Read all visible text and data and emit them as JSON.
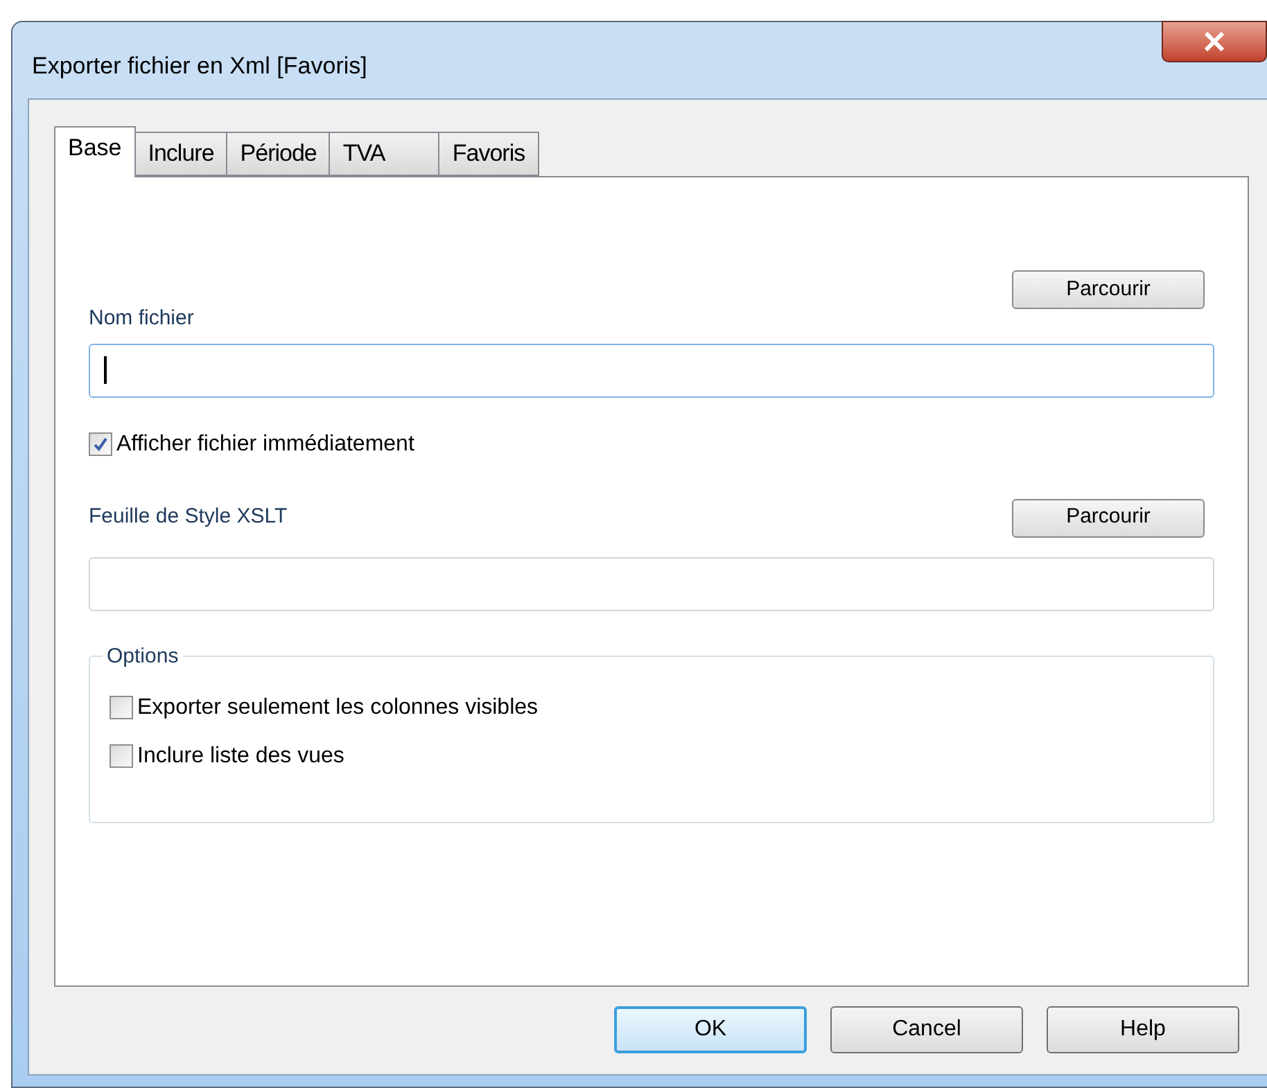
{
  "window": {
    "title": "Exporter fichier en Xml [Favoris]"
  },
  "tabs": [
    {
      "label": "Base",
      "selected": true
    },
    {
      "label": "Inclure",
      "selected": false
    },
    {
      "label": "Période",
      "selected": false
    },
    {
      "label": "TVA",
      "selected": false
    },
    {
      "label": "Favoris",
      "selected": false
    }
  ],
  "file_name": {
    "label": "Nom fichier",
    "browse_button": "Parcourir",
    "focused": true
  },
  "show_file": {
    "label": "Afficher fichier immédiatement",
    "checked": true
  },
  "stylesheet": {
    "label": "Feuille de Style XSLT",
    "browse_button": "Parcourir",
    "focused": false
  },
  "options": {
    "title": "Options",
    "items": [
      {
        "label": "Exporter seulement les colonnes visibles",
        "checked": false
      },
      {
        "label": "Inclure liste des vues",
        "checked": false
      }
    ]
  },
  "buttons": [
    {
      "label": "OK",
      "default": true
    },
    {
      "label": "Cancel",
      "default": false
    },
    {
      "label": "Help",
      "default": false
    }
  ]
}
